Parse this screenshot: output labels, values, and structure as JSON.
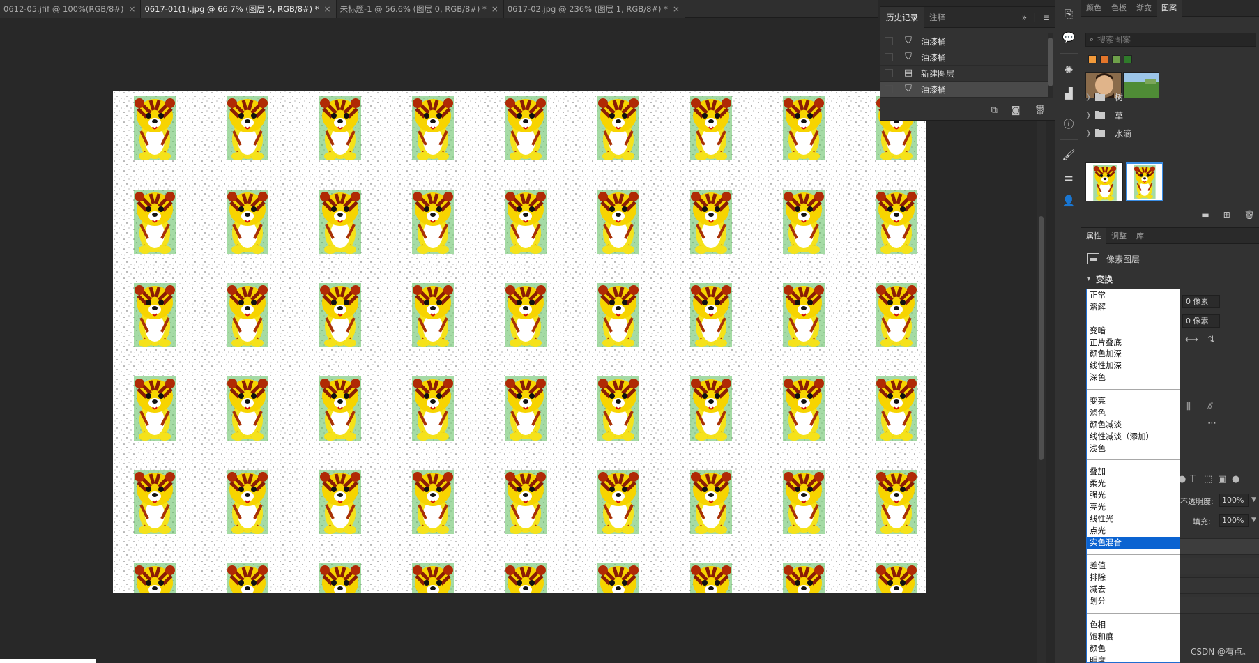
{
  "doc_tabs": [
    {
      "label": "0612-05.jfif @ 100%(RGB/8#)",
      "active": false
    },
    {
      "label": "0617-01(1).jpg @ 66.7% (图层 5, RGB/8#) *",
      "active": true
    },
    {
      "label": "未标题-1 @ 56.6% (图层 0, RGB/8#) *",
      "active": false
    },
    {
      "label": "0617-02.jpg @ 236% (图层 1, RGB/8#) *",
      "active": false
    }
  ],
  "close_glyph": "×",
  "history_panel": {
    "tabs": [
      "历史记录",
      "注释"
    ],
    "menu_glyph": "» │ ≡",
    "items": [
      {
        "label": "油漆桶",
        "icon": "paint-bucket-icon",
        "glyph": "⛉",
        "selected": false
      },
      {
        "label": "油漆桶",
        "icon": "paint-bucket-icon",
        "glyph": "⛉",
        "selected": false
      },
      {
        "label": "新建图层",
        "icon": "new-layer-icon",
        "glyph": "▤",
        "selected": false
      },
      {
        "label": "油漆桶",
        "icon": "paint-bucket-icon",
        "glyph": "⛉",
        "selected": true
      }
    ],
    "footer": {
      "snapshot_glyph": "⧉",
      "camera_glyph": "◙",
      "trash_glyph": "🗑"
    }
  },
  "top_tabs": [
    "颜色",
    "色板",
    "渐变",
    "图案"
  ],
  "active_top_tab": "图案",
  "pattern_search": {
    "placeholder": "搜索图案",
    "icon_glyph": "⌕"
  },
  "pattern_folders": [
    "树",
    "草",
    "水滴"
  ],
  "props_tabs": [
    "属性",
    "调整",
    "库"
  ],
  "layer_type": "像素图层",
  "transform_label": "变换",
  "px_fields": [
    "0 像素",
    "0 像素"
  ],
  "opacity": {
    "label": "不透明度:",
    "value": "100%"
  },
  "fill": {
    "label": "填充:",
    "value": "100%"
  },
  "blend_modes": [
    [
      "正常",
      "溶解"
    ],
    [
      "变暗",
      "正片叠底",
      "颜色加深",
      "线性加深",
      "深色"
    ],
    [
      "变亮",
      "滤色",
      "颜色减淡",
      "线性减淡（添加）",
      "浅色"
    ],
    [
      "叠加",
      "柔光",
      "强光",
      "亮光",
      "线性光",
      "点光",
      "实色混合"
    ],
    [
      "差值",
      "排除",
      "减去",
      "划分"
    ],
    [
      "色相",
      "饱和度",
      "颜色",
      "明度"
    ]
  ],
  "selected_blend_mode": "实色混合",
  "watermark": "CSDN @有点。",
  "strip_glyphs": {
    "history": "⎘",
    "comment": "💬",
    "brush_settings": "✺",
    "levels": "▟",
    "info": "ⓘ",
    "brush": "🖌",
    "adjust": "⚌",
    "person": "👤"
  },
  "layer_tool_glyphs": [
    "T",
    "⬚",
    "▣",
    "●"
  ],
  "align_glyphs": [
    "⟷",
    "⇅",
    "⫼",
    "⫻",
    "⋯"
  ]
}
